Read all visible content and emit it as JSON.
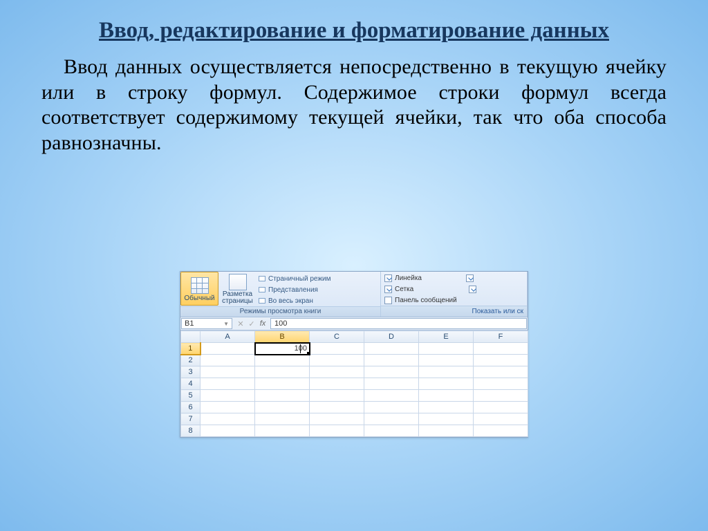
{
  "slide": {
    "title": "Ввод, редактирование и форматирование данных",
    "body": "Ввод данных осуществляется непосредственно в текущую ячейку или в строку формул. Содержимое строки формул всегда соответствует содержимому текущей ячейки, так что оба способа равнозначны."
  },
  "ribbon": {
    "group_views": {
      "label": "Режимы просмотра книги",
      "normal": "Обычный",
      "pagelayout": "Разметка страницы",
      "pagebreak": "Страничный режим",
      "custom": "Представления",
      "fullscreen": "Во весь экран"
    },
    "group_show": {
      "ruler": "Линейка",
      "gridlines": "Сетка",
      "msgbar": "Панель сообщений",
      "link": "Показать или ск"
    }
  },
  "formula_bar": {
    "name": "B1",
    "fx": "fx",
    "value": "100"
  },
  "grid": {
    "cols": [
      "A",
      "B",
      "C",
      "D",
      "E",
      "F"
    ],
    "rows": [
      "1",
      "2",
      "3",
      "4",
      "5",
      "6",
      "7",
      "8"
    ],
    "active": {
      "row": 0,
      "col": 1,
      "value": "100"
    }
  }
}
